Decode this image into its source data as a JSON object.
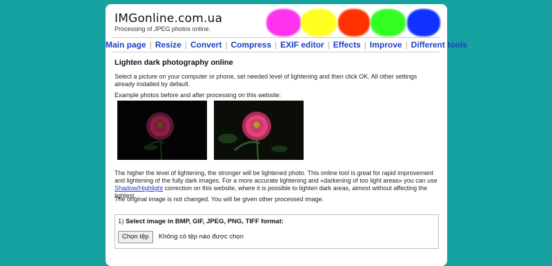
{
  "header": {
    "site_title": "IMGonline.com.ua",
    "site_subtitle": "Processing of JPEG photos online."
  },
  "color_blobs": [
    "#ff33ee",
    "#ffff22",
    "#ff3300",
    "#33ff22",
    "#1133ff"
  ],
  "nav": {
    "items": [
      "Main page",
      "Resize",
      "Convert",
      "Compress",
      "EXIF editor",
      "Effects",
      "Improve",
      "Different tools"
    ],
    "separator": "|"
  },
  "main": {
    "heading": "Lighten dark photography online",
    "intro": "Select a picture on your computer or phone, set needed level of lightening and then click OK. All other settings already installed by default.",
    "examples_caption": "Example photos before and after processing on this website:",
    "photos": [
      {
        "name": "before",
        "flower_color": "#8a1f45"
      },
      {
        "name": "after",
        "flower_color": "#e0457a"
      }
    ],
    "description_before_link": "The higher the level of lightening, the stronger will be lightened photo. This online tool is great for rapid improvement and lightening of the fully dark images. For a more accurate lightening and «darkening of too light areas» you can use",
    "description_link": "Shadow/Highlight",
    "description_after_link": "correction on this website, where it is possible to lighten dark areas, almost without affecting the lightest.",
    "note": "The original image is not changed. You will be given other processed image."
  },
  "form": {
    "step_number": "1)",
    "step_label": "Select image in BMP, GIF, JPEG, PNG, TIFF format:",
    "file_button": "Chọn tệp",
    "file_status": "Không có tệp nào được chọn"
  }
}
